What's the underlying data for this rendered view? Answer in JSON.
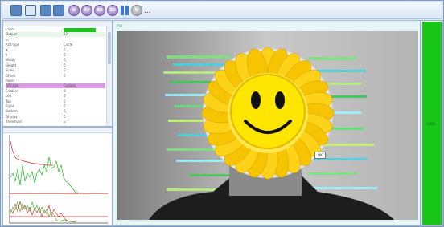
{
  "toolbar": {
    "buttons": [
      {
        "name": "camera-source-button",
        "icon": "camera-icon"
      },
      {
        "name": "image-source-button",
        "icon": "image-icon"
      },
      {
        "name": "display-mode-button",
        "icon": "display-icon"
      },
      {
        "name": "grid-mode-button",
        "icon": "grid-icon"
      }
    ],
    "circle_buttons": [
      {
        "name": "mode-n-button",
        "label": "N"
      },
      {
        "name": "mode-av-button",
        "label": "AV"
      },
      {
        "name": "mode-ar-button",
        "label": "AR"
      },
      {
        "name": "mode-sd-button",
        "label": "SD"
      }
    ],
    "extra_circle": {
      "label": "R"
    },
    "more_label": "..."
  },
  "props": {
    "rows": [
      {
        "name": "Label",
        "value": ""
      },
      {
        "name": "Output",
        "value": "33"
      },
      {
        "name": "In",
        "value": ""
      },
      {
        "name": "ROI type",
        "value": "Circle"
      },
      {
        "name": "X",
        "value": "0"
      },
      {
        "name": "Y",
        "value": "0"
      },
      {
        "name": "Width",
        "value": "0"
      },
      {
        "name": "Height",
        "value": "0"
      },
      {
        "name": "Scale",
        "value": "0"
      },
      {
        "name": "Offset",
        "value": "0"
      },
      {
        "name": "Reset",
        "value": ""
      },
      {
        "name": "ROI size",
        "value": "Custom"
      },
      {
        "name": "Enabled",
        "value": "0"
      },
      {
        "name": "Left",
        "value": "0"
      },
      {
        "name": "Top",
        "value": "0"
      },
      {
        "name": "Right",
        "value": "0"
      },
      {
        "name": "Bottom",
        "value": "0"
      },
      {
        "name": "Display",
        "value": "0"
      },
      {
        "name": "Threshold",
        "value": "0"
      }
    ]
  },
  "video": {
    "corner_label": "ROI",
    "tooltip": "OK"
  },
  "right_bar": {
    "label": "100%",
    "level": 1.0
  },
  "colors": {
    "accent_green": "#19c719",
    "highlight_pink": "#d89be0",
    "bar_red": "#cc2222",
    "bar_green": "#1fb81f"
  }
}
